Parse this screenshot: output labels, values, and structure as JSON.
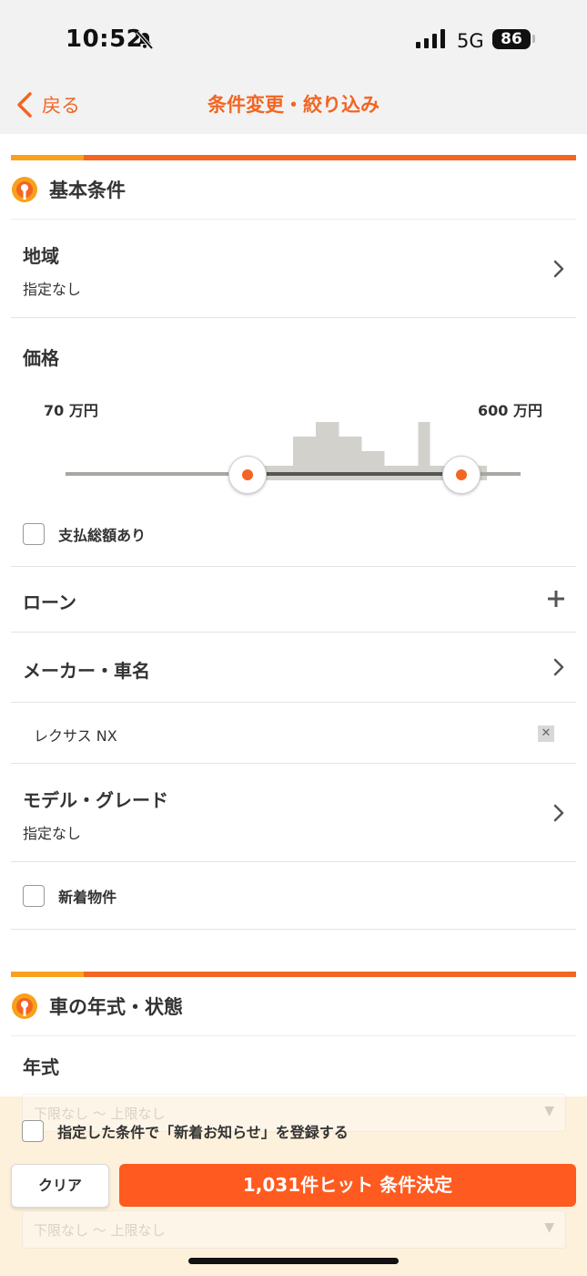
{
  "status": {
    "time": "10:52",
    "network": "5G",
    "battery": "86"
  },
  "nav": {
    "back_label": "戻る",
    "title": "条件変更・絞り込み"
  },
  "basic": {
    "title": "基本条件",
    "region": {
      "label": "地域",
      "value": "指定なし"
    },
    "price": {
      "label": "価格",
      "min_label": "70 万円",
      "max_label": "600 万円",
      "range_min_fraction": 0.4,
      "range_max_fraction": 0.87,
      "histogram": [
        0,
        0,
        0,
        0,
        0,
        0,
        0,
        0,
        0,
        0,
        0,
        0,
        0,
        0,
        0,
        1,
        1,
        1,
        1,
        1,
        3,
        3,
        4,
        4,
        3,
        3,
        2,
        2,
        1,
        1,
        1,
        4,
        1,
        1,
        1,
        1,
        1,
        0,
        0,
        0
      ]
    },
    "total_payment_label": "支払総額あり",
    "loan_label": "ローン",
    "maker": {
      "label": "メーカー・車名",
      "tag": "レクサス NX"
    },
    "model": {
      "label": "モデル・グレード",
      "value": "指定なし"
    },
    "new_arrival_label": "新着物件"
  },
  "year_section": {
    "title": "車の年式・状態",
    "year_label": "年式",
    "year_select_value": "下限なし 〜 上限なし"
  },
  "footer": {
    "notify_label": "指定した条件で「新着お知らせ」を登録する",
    "clear_label": "クリア",
    "submit_label": "1,031件ヒット 条件決定"
  },
  "colors": {
    "accent": "#f26522",
    "accent_light": "#f9a11b",
    "submit": "#ff5a1f",
    "footer_bg": "#fdf1dc"
  }
}
